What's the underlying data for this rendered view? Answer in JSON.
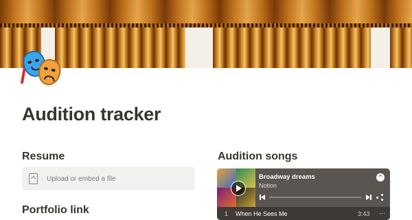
{
  "page": {
    "title": "Audition tracker"
  },
  "sections": {
    "resume_heading": "Resume",
    "songs_heading": "Audition songs",
    "portfolio_heading": "Portfolio link"
  },
  "upload": {
    "label": "Upload or embed a file",
    "icon": "file-upload-icon"
  },
  "spotify": {
    "playlist_title": "Broadway dreams",
    "playlist_owner": "Notion",
    "tracks": [
      {
        "number": "1",
        "name": "When He Sees Me",
        "duration": "3:43"
      }
    ],
    "more_label": "···",
    "icons": [
      "play-icon",
      "spotify-logo-icon",
      "previous-track-icon",
      "next-track-icon",
      "share-icon"
    ]
  },
  "colors": {
    "text": "#37352f",
    "upload_bg": "#f1f1ef",
    "embed_bg": "#5b5551",
    "accent_curtain": "#c97a22"
  }
}
